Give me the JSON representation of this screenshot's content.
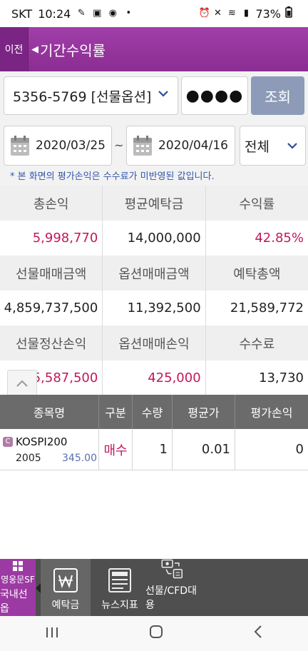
{
  "status": {
    "carrier": "SKT",
    "time": "10:24",
    "battery": "73%"
  },
  "header": {
    "back_label": "이전",
    "title": "기간수익률"
  },
  "account": {
    "value": "5356-5769 [선물옵션]",
    "password": "●●●●",
    "query_label": "조회"
  },
  "dates": {
    "from": "2020/03/25",
    "sep": "~",
    "to": "2020/04/16",
    "type": "전체"
  },
  "notice": "* 본 화면의 평가손익은 수수료가 미반영된 값입니다.",
  "summary": {
    "h1": [
      "총손익",
      "평균예탁금",
      "수익률"
    ],
    "v1": [
      "5,998,770",
      "14,000,000",
      "42.85%"
    ],
    "h2": [
      "선물매매금액",
      "옵션매매금액",
      "예탁총액"
    ],
    "v2": [
      "4,859,737,500",
      "11,392,500",
      "21,589,772"
    ],
    "h3": [
      "선물정산손익",
      "옵션매매손익",
      "수수료"
    ],
    "v3": [
      "5,587,500",
      "425,000",
      "13,730"
    ]
  },
  "table": {
    "headers": [
      "종목명",
      "구분",
      "수량",
      "평균가",
      "평가손익"
    ],
    "rows": [
      {
        "badge": "C",
        "name": "KOSPI200",
        "code": "2005",
        "price": "345.00",
        "side": "매수",
        "qty": "1",
        "avg": "0.01",
        "pnl": "0"
      }
    ]
  },
  "tabs": {
    "home_logo": "영웅문SF",
    "home": "국내선옵",
    "deposit": "예탁금",
    "news": "뉴스지표",
    "cfd": "선물/CFD대용"
  },
  "colors": {
    "accent": "#9c3aa3",
    "profit": "#c2185b",
    "query_btn": "#8d9bb8"
  }
}
